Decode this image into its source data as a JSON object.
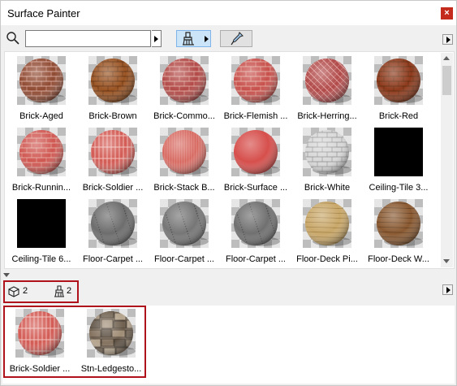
{
  "window": {
    "title": "Surface Painter",
    "close_label": "×"
  },
  "toolbar": {
    "search": {
      "value": "",
      "placeholder": ""
    },
    "brush_icon": "paint-brush-icon",
    "picker_icon": "eyedropper-icon"
  },
  "materials": [
    {
      "label": "Brick-Aged",
      "kind": "brick",
      "color": "#8f4a32"
    },
    {
      "label": "Brick-Brown",
      "kind": "brick-brown",
      "color": "#9a5423"
    },
    {
      "label": "Brick-Commo...",
      "kind": "brick",
      "color": "#b24a48"
    },
    {
      "label": "Brick-Flemish ...",
      "kind": "brick",
      "color": "#c8504c"
    },
    {
      "label": "Brick-Herring...",
      "kind": "herring",
      "color": "#b14a4a"
    },
    {
      "label": "Brick-Red",
      "kind": "brick-brown",
      "color": "#8e3a1c"
    },
    {
      "label": "Brick-Runnin...",
      "kind": "brick",
      "color": "#d05752"
    },
    {
      "label": "Brick-Soldier ...",
      "kind": "soldier",
      "color": "#d35b55"
    },
    {
      "label": "Brick-Stack B...",
      "kind": "stack",
      "color": "#d5665e"
    },
    {
      "label": "Brick-Surface ...",
      "kind": "plain",
      "color": "#d64f4c"
    },
    {
      "label": "Brick-White",
      "kind": "white",
      "color": "#d8d8d8"
    },
    {
      "label": "Ceiling-Tile 3...",
      "kind": "black",
      "color": "#000000"
    },
    {
      "label": "Ceiling-Tile 6...",
      "kind": "black",
      "color": "#000000"
    },
    {
      "label": "Floor-Carpet ...",
      "kind": "carpet",
      "color": "#6d6d6d"
    },
    {
      "label": "Floor-Carpet ...",
      "kind": "carpet",
      "color": "#767676"
    },
    {
      "label": "Floor-Carpet ...",
      "kind": "carpet",
      "color": "#707070"
    },
    {
      "label": "Floor-Deck Pi...",
      "kind": "deck",
      "color": "#c9a86a"
    },
    {
      "label": "Floor-Deck W...",
      "kind": "deck-dark",
      "color": "#8a5a32"
    }
  ],
  "counts": {
    "elements": "2",
    "surfaces": "2",
    "element_icon": "cube-icon",
    "surface_icon": "paint-brush-icon"
  },
  "selected": [
    {
      "label": "Brick-Soldier ...",
      "kind": "soldier",
      "color": "#d35b55"
    },
    {
      "label": "Stn-Ledgesto...",
      "kind": "stone",
      "color": "#8c7a66"
    }
  ],
  "colors": {
    "selection_border": "#b0121b",
    "accent_blue": "#cce4f7"
  }
}
